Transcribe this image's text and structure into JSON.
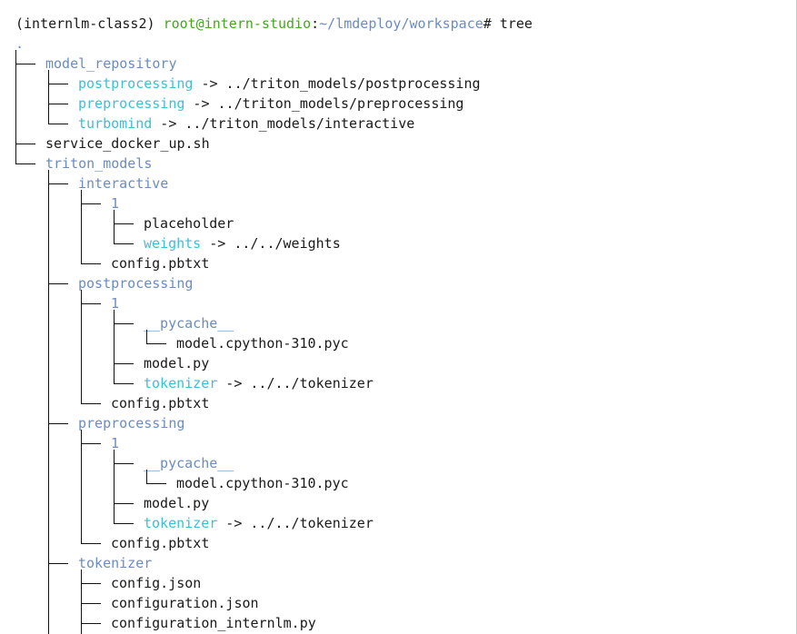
{
  "prompt": {
    "env": "(internlm-class2) ",
    "user_host": "root@intern-studio",
    "colon": ":",
    "path": "~/lmdeploy/workspace",
    "suffix": "# ",
    "command": "tree"
  },
  "tree": [
    {
      "depth": 0,
      "text": ".",
      "kind": "dir",
      "last": false
    },
    {
      "depth": 1,
      "text": "model_repository",
      "kind": "dir",
      "last": false
    },
    {
      "depth": 2,
      "text": "postprocessing",
      "kind": "link",
      "target": " -> ../triton_models/postprocessing",
      "last": false
    },
    {
      "depth": 2,
      "text": "preprocessing",
      "kind": "link",
      "target": " -> ../triton_models/preprocessing",
      "last": false
    },
    {
      "depth": 2,
      "text": "turbomind",
      "kind": "link",
      "target": " -> ../triton_models/interactive",
      "last": true
    },
    {
      "depth": 1,
      "text": "service_docker_up.sh",
      "kind": "file",
      "last": false
    },
    {
      "depth": 1,
      "text": "triton_models",
      "kind": "dir",
      "last": true
    },
    {
      "depth": 2,
      "text": "interactive",
      "kind": "dir",
      "last": false
    },
    {
      "depth": 3,
      "text": "1",
      "kind": "dir",
      "last": false
    },
    {
      "depth": 4,
      "text": "placeholder",
      "kind": "file",
      "last": false
    },
    {
      "depth": 4,
      "text": "weights",
      "kind": "link",
      "target": " -> ../../weights",
      "last": true
    },
    {
      "depth": 3,
      "text": "config.pbtxt",
      "kind": "file",
      "last": true
    },
    {
      "depth": 2,
      "text": "postprocessing",
      "kind": "dir",
      "last": false
    },
    {
      "depth": 3,
      "text": "1",
      "kind": "dir",
      "last": false
    },
    {
      "depth": 4,
      "text": "__pycache__",
      "kind": "dir",
      "last": false
    },
    {
      "depth": 5,
      "text": "model.cpython-310.pyc",
      "kind": "file",
      "last": true
    },
    {
      "depth": 4,
      "text": "model.py",
      "kind": "file",
      "last": false
    },
    {
      "depth": 4,
      "text": "tokenizer",
      "kind": "link",
      "target": " -> ../../tokenizer",
      "last": true
    },
    {
      "depth": 3,
      "text": "config.pbtxt",
      "kind": "file",
      "last": true
    },
    {
      "depth": 2,
      "text": "preprocessing",
      "kind": "dir",
      "last": false
    },
    {
      "depth": 3,
      "text": "1",
      "kind": "dir",
      "last": false
    },
    {
      "depth": 4,
      "text": "__pycache__",
      "kind": "dir",
      "last": false
    },
    {
      "depth": 5,
      "text": "model.cpython-310.pyc",
      "kind": "file",
      "last": true
    },
    {
      "depth": 4,
      "text": "model.py",
      "kind": "file",
      "last": false
    },
    {
      "depth": 4,
      "text": "tokenizer",
      "kind": "link",
      "target": " -> ../../tokenizer",
      "last": true
    },
    {
      "depth": 3,
      "text": "config.pbtxt",
      "kind": "file",
      "last": true
    },
    {
      "depth": 2,
      "text": "tokenizer",
      "kind": "dir",
      "last": false
    },
    {
      "depth": 3,
      "text": "config.json",
      "kind": "file",
      "last": false
    },
    {
      "depth": 3,
      "text": "configuration.json",
      "kind": "file",
      "last": false
    },
    {
      "depth": 3,
      "text": "configuration_internlm.py",
      "kind": "file",
      "last": false
    }
  ],
  "colors": {
    "directory": "#6b8cc2",
    "symlink": "#3dbfd3",
    "user_host": "#44a71f",
    "text": "#1a1a1a"
  }
}
